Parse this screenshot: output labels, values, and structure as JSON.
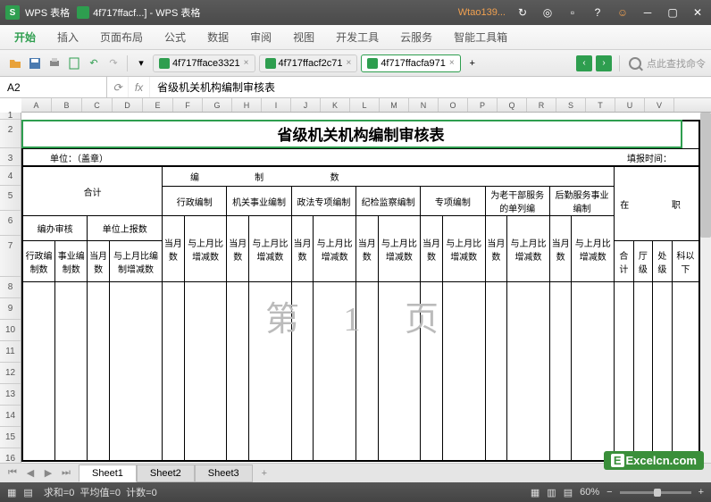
{
  "titlebar": {
    "app": "WPS 表格",
    "file": "4f717ffacf...] - WPS 表格",
    "user": "Wtao139..."
  },
  "menu": [
    "开始",
    "插入",
    "页面布局",
    "公式",
    "数据",
    "审阅",
    "视图",
    "开发工具",
    "云服务",
    "智能工具箱"
  ],
  "tabs": {
    "files": [
      "4f717fface3321",
      "4f717ffacf2c71",
      "4f717ffacfa971"
    ],
    "active": 2,
    "search_placeholder": "点此查找命令"
  },
  "formula": {
    "cellref": "A2",
    "fx": "fx",
    "content": "省级机关机构编制审核表"
  },
  "columns": [
    "A",
    "B",
    "C",
    "D",
    "E",
    "F",
    "G",
    "H",
    "I",
    "J",
    "K",
    "L",
    "M",
    "N",
    "O",
    "P",
    "Q",
    "R",
    "S",
    "T",
    "U",
    "V"
  ],
  "rows": [
    "1",
    "2",
    "3",
    "4",
    "5",
    "6",
    "7",
    "8",
    "9",
    "10",
    "11",
    "12",
    "13",
    "14",
    "15",
    "16"
  ],
  "sheet": {
    "title": "省级机关机构编制审核表",
    "unit_label": "单位：（盖章）",
    "report_time": "填报时间：",
    "header_row1": {
      "a": "编",
      "b": "制",
      "c": "数",
      "d": "在",
      "e": "职"
    },
    "header_row2": [
      "合计",
      "行政编制",
      "机关事业编制",
      "政法专项编制",
      "纪检监察编制",
      "专项编制",
      "为老干部服务的单列编",
      "后勤服务事业编制"
    ],
    "header_row3_left": [
      "编办审核",
      "单位上报数"
    ],
    "header_row3_pair": {
      "a": "当月数",
      "b": "与上月比增减数"
    },
    "header_row4": [
      "行政编制数",
      "事业编制数",
      "当月数",
      "与上月比编制增减数"
    ],
    "right_cols": [
      "合计",
      "厅级",
      "处级",
      "科以下"
    ],
    "watermark": "第 1 页"
  },
  "sheets": [
    "Sheet1",
    "Sheet2",
    "Sheet3"
  ],
  "active_sheet": 0,
  "status": {
    "sum": "求和=0",
    "avg": "平均值=0",
    "count": "计数=0",
    "zoom": "60%"
  },
  "brand": "Excelcn.com"
}
